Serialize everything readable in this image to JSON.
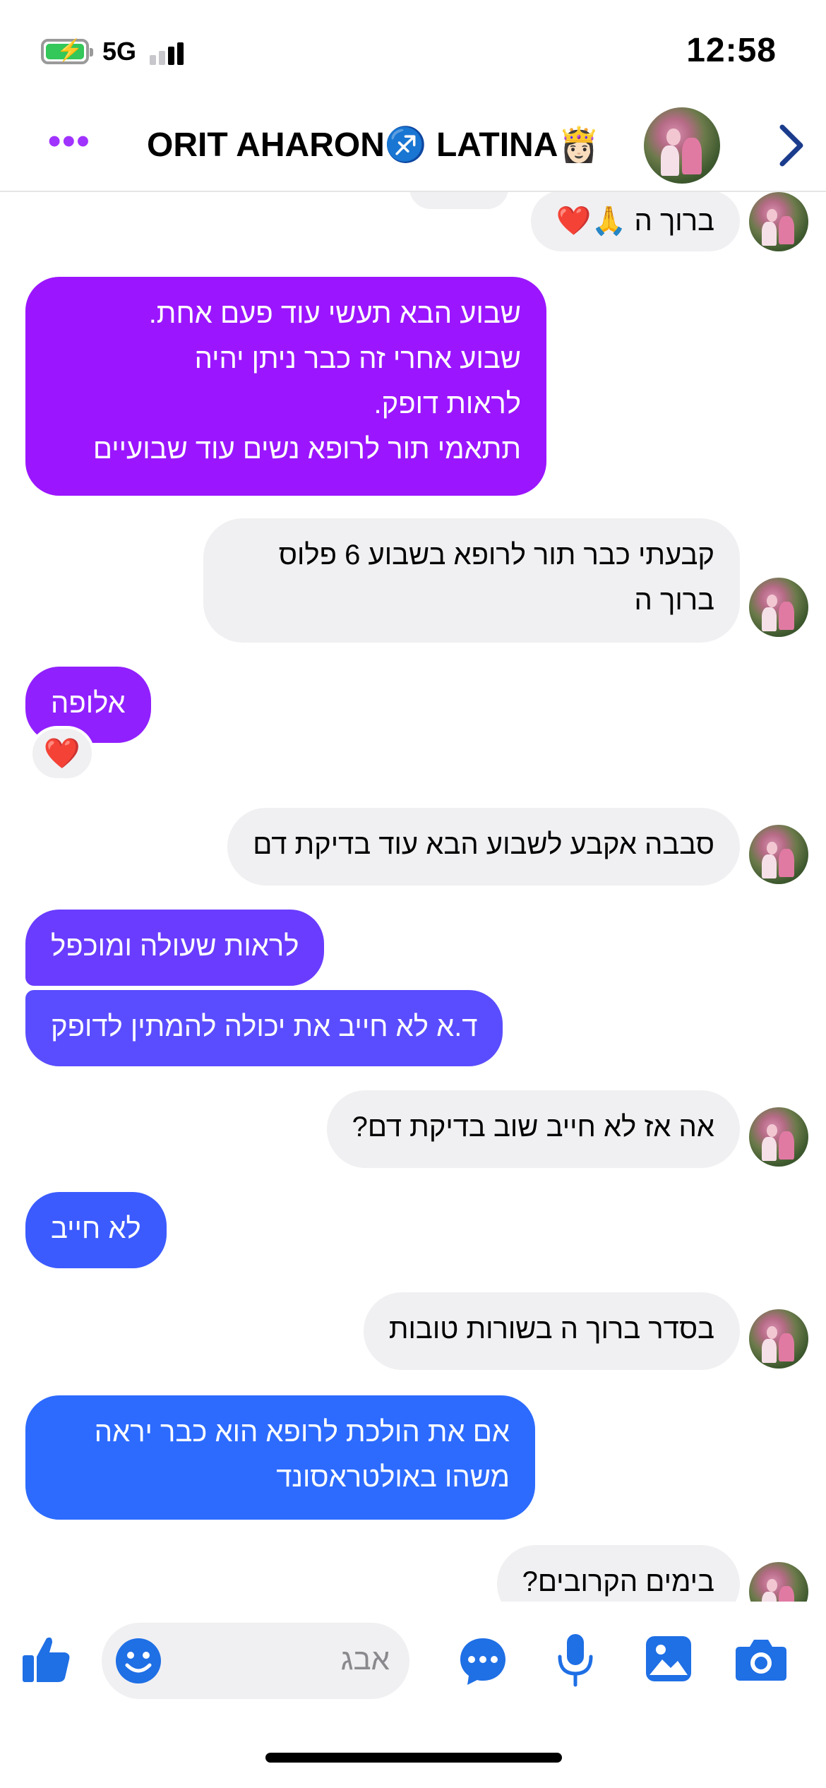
{
  "status_bar": {
    "time": "12:58",
    "network": "5G"
  },
  "header": {
    "more_label": "•••",
    "title": "ORIT AHARON♐ LATINA👸🏻"
  },
  "messages": [
    {
      "dir": "in",
      "text": "ברוך ה 🙏❤️"
    },
    {
      "dir": "out",
      "lines": [
        "שבוע הבא תעשי עוד פעם אחת.",
        "שבוע אחרי זה כבר ניתן יהיה",
        "לראות דופק.",
        "תתאמי תור לרופא נשים עוד שבועיים"
      ]
    },
    {
      "dir": "in",
      "lines": [
        "קבעתי כבר תור לרופא בשבוע 6 פלוס",
        "ברוך ה"
      ]
    },
    {
      "dir": "out",
      "text": "אלופה",
      "reaction": "❤️"
    },
    {
      "dir": "in",
      "text": "סבבה אקבע לשבוע הבא עוד בדיקת דם"
    },
    {
      "dir": "out",
      "text": "לראות שעולה ומוכפל"
    },
    {
      "dir": "out",
      "text": "ד.א לא חייב את יכולה להמתין לדופק"
    },
    {
      "dir": "in",
      "text": "אה אז לא חייב שוב בדיקת דם?"
    },
    {
      "dir": "out",
      "text": "לא חייב"
    },
    {
      "dir": "in",
      "text": "בסדר ברוך ה בשורות טובות"
    },
    {
      "dir": "out",
      "lines": [
        "אם את הולכת לרופא הוא כבר יראה",
        "משהו באולטראסונד"
      ]
    },
    {
      "dir": "in",
      "text": "בימים הקרובים?"
    }
  ],
  "composer": {
    "placeholder": "אבג"
  },
  "colors": {
    "accent_purple": "#9b1bff",
    "accent_blue": "#2d6bff",
    "incoming_bubble": "#f0f0f2",
    "icon_blue": "#1f6fe5"
  },
  "icons": [
    "battery-charging-icon",
    "signal-icon",
    "more-icon",
    "chevron-right-icon",
    "like-icon",
    "emoji-icon",
    "more-actions-icon",
    "microphone-icon",
    "gallery-icon",
    "camera-icon"
  ]
}
